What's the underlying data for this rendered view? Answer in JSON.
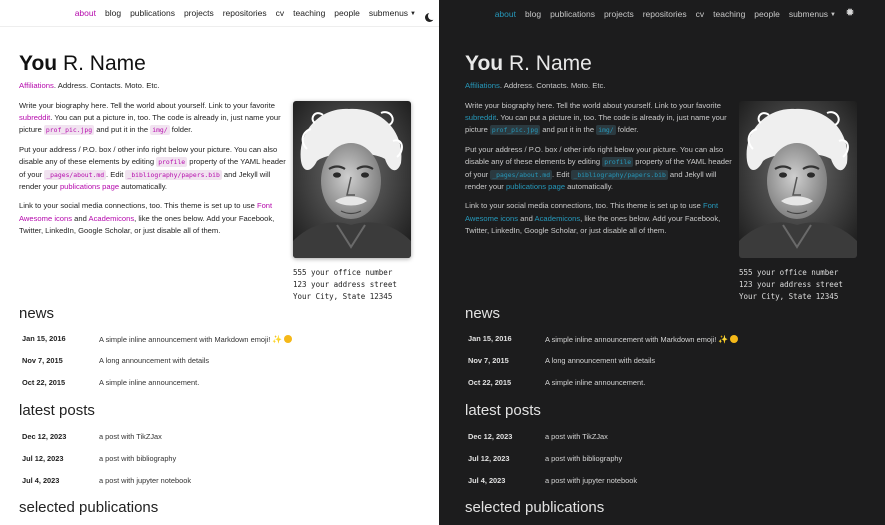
{
  "nav": {
    "items": [
      "about",
      "blog",
      "publications",
      "projects",
      "repositories",
      "cv",
      "teaching",
      "people"
    ],
    "submenus_label": "submenus"
  },
  "header": {
    "first": "You",
    "rest": "R. Name",
    "affiliations": "Affiliations",
    "details": ". Address. Contacts. Moto. Etc."
  },
  "bio": {
    "p1_a": "Write your biography here. Tell the world about yourself. Link to your favorite ",
    "p1_link": "subreddit",
    "p1_b": ". You can put a picture in, too. The code is already in, just name your picture ",
    "p1_code1": "prof_pic.jpg",
    "p1_c": " and put it in the ",
    "p1_code2": "img/",
    "p1_d": " folder.",
    "p2_a": "Put your address / P.O. box / other info right below your picture. You can also disable any of these elements by editing ",
    "p2_code1": "profile",
    "p2_b": " property of the YAML header of your ",
    "p2_code2": "_pages/about.md",
    "p2_c": ". Edit ",
    "p2_code3": "_bibliography/papers.bib",
    "p2_d": " and Jekyll will render your ",
    "p2_link": "publications page",
    "p2_e": " automatically.",
    "p3_a": "Link to your social media connections, too. This theme is set up to use ",
    "p3_link1": "Font Awesome icons",
    "p3_b": " and ",
    "p3_link2": "Academicons",
    "p3_c": ", like the ones below. Add your Facebook, Twitter, LinkedIn, Google Scholar, or just disable all of them."
  },
  "address": [
    "555 your office number",
    "123 your address street",
    "Your City, State 12345"
  ],
  "news": {
    "title": "news",
    "items": [
      {
        "date": "Jan 15, 2016",
        "text": "A simple inline announcement with Markdown emoji!"
      },
      {
        "date": "Nov 7, 2015",
        "text": "A long announcement with details"
      },
      {
        "date": "Oct 22, 2015",
        "text": "A simple inline announcement."
      }
    ]
  },
  "posts": {
    "title": "latest posts",
    "items": [
      {
        "date": "Dec 12, 2023",
        "text": "a post with TikZJax"
      },
      {
        "date": "Jul 12, 2023",
        "text": "a post with bibliography"
      },
      {
        "date": "Jul 4, 2023",
        "text": "a post with jupyter notebook"
      }
    ]
  },
  "publications": {
    "title": "selected publications"
  },
  "colors": {
    "light_accent": "#b509ac",
    "dark_accent": "#2698ba",
    "dark_bg": "#1c1c1d"
  },
  "icons": {
    "light_toggle": "moon-icon",
    "dark_toggle": "sun-icon",
    "submenu": "caret-down-icon"
  }
}
